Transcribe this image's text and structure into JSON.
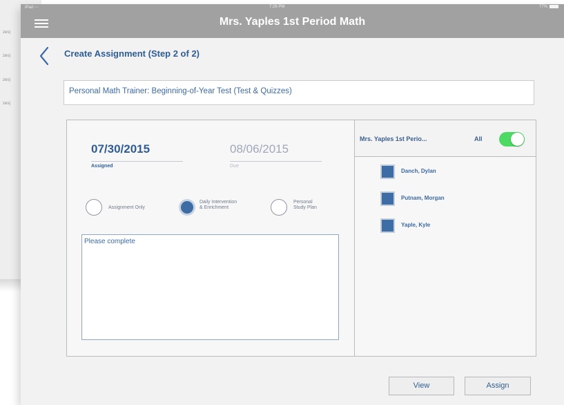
{
  "status_bar": {
    "carrier": "iPad ⋯",
    "time": "7:26 PM",
    "battery": "77%"
  },
  "header": {
    "title": "Mrs. Yaples 1st Period Math",
    "menu_icon": "hamburger-icon"
  },
  "page": {
    "back_icon": "chevron-left-icon",
    "title": "Create Assignment (Step 2 of 2)"
  },
  "assignment": {
    "name": "Personal Math Trainer: Beginning-of-Year Test (Test & Quizzes)"
  },
  "dates": {
    "assigned_value": "07/30/2015",
    "assigned_caption": "Assigned",
    "due_value": "08/06/2015",
    "due_caption": "Due"
  },
  "assignment_types": [
    {
      "label": "Assignment Only",
      "selected": false
    },
    {
      "label_line1": "Daily Intervention",
      "label_line2": "& Enrichment",
      "selected": true
    },
    {
      "label_line1": "Personal",
      "label_line2": "Study Plan",
      "selected": false
    }
  ],
  "notes": {
    "value": "Please complete"
  },
  "roster": {
    "class_name": "Mrs. Yaples 1st Perio...",
    "all_label": "All",
    "all_toggle_on": true,
    "toggle_color": "#4cd964",
    "students": [
      {
        "name": "Danch, Dylan",
        "checked": true
      },
      {
        "name": "Putnam, Morgan",
        "checked": true
      },
      {
        "name": "Yaple, Kyle",
        "checked": true
      }
    ]
  },
  "actions": {
    "view_label": "View",
    "assign_label": "Assign"
  },
  "background_list": [
    "zes)",
    "zes)",
    "zes)",
    "zes)"
  ],
  "colors": {
    "accent": "#2f5d93",
    "nav_bar": "#a1a1a1",
    "selected_fill": "#3d6da4"
  }
}
